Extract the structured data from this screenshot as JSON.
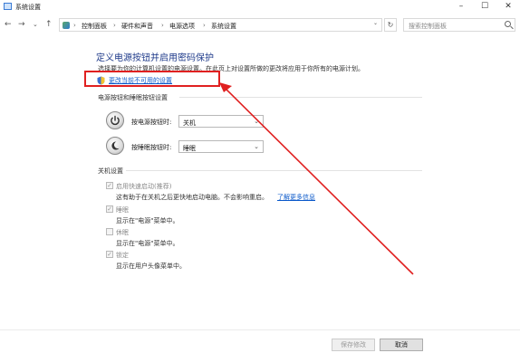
{
  "window": {
    "title": "系统设置",
    "minimize_glyph": "–",
    "maximize_glyph": "☐",
    "close_glyph": "✕"
  },
  "nav": {
    "back_glyph": "←",
    "forward_glyph": "→",
    "dropdown_glyph": "⌄",
    "up_glyph": "↑",
    "crumb_sep": "›",
    "address_dropdown_glyph": "⌄",
    "refresh_glyph": "↻",
    "breadcrumbs": [
      "控制面板",
      "硬件和声音",
      "电源选项",
      "系统设置"
    ],
    "search_placeholder": "搜索控制面板"
  },
  "main": {
    "title": "定义电源按钮并启用密码保护",
    "description": "选择要为你的计算机设置的电源设置。在此页上对设置所做的更改将应用于你所有的电源计划。",
    "change_link": "更改当前不可用的设置"
  },
  "power_buttons": {
    "heading": "电源按钮和睡眠按钮设置",
    "power_label": "按电源按钮时:",
    "power_value": "关机",
    "sleep_label": "按睡眠按钮时:",
    "sleep_value": "睡眠",
    "chevron": "⌄"
  },
  "shutdown_settings": {
    "heading": "关机设置",
    "check_glyph": "✓",
    "items": [
      {
        "label": "启用快速启动(推荐)",
        "checked": true,
        "desc": "这有助于在关机之后更快地启动电脑。不会影响重启。",
        "link": "了解更多信息"
      },
      {
        "label": "睡眠",
        "checked": true,
        "desc": "显示在\"电源\"菜单中。"
      },
      {
        "label": "休眠",
        "checked": false,
        "desc": "显示在\"电源\"菜单中。"
      },
      {
        "label": "锁定",
        "checked": true,
        "desc": "显示在用户头像菜单中。"
      }
    ]
  },
  "footer": {
    "save_label": "保存修改",
    "cancel_label": "取消"
  },
  "colors": {
    "title_blue": "#1e3a8a",
    "link_blue": "#0a58ca",
    "annotation_red": "#e02020"
  },
  "icons": [
    "app-icon",
    "control-panel-icon",
    "search-icon",
    "shield-icon",
    "power-icon",
    "sleep-icon"
  ]
}
